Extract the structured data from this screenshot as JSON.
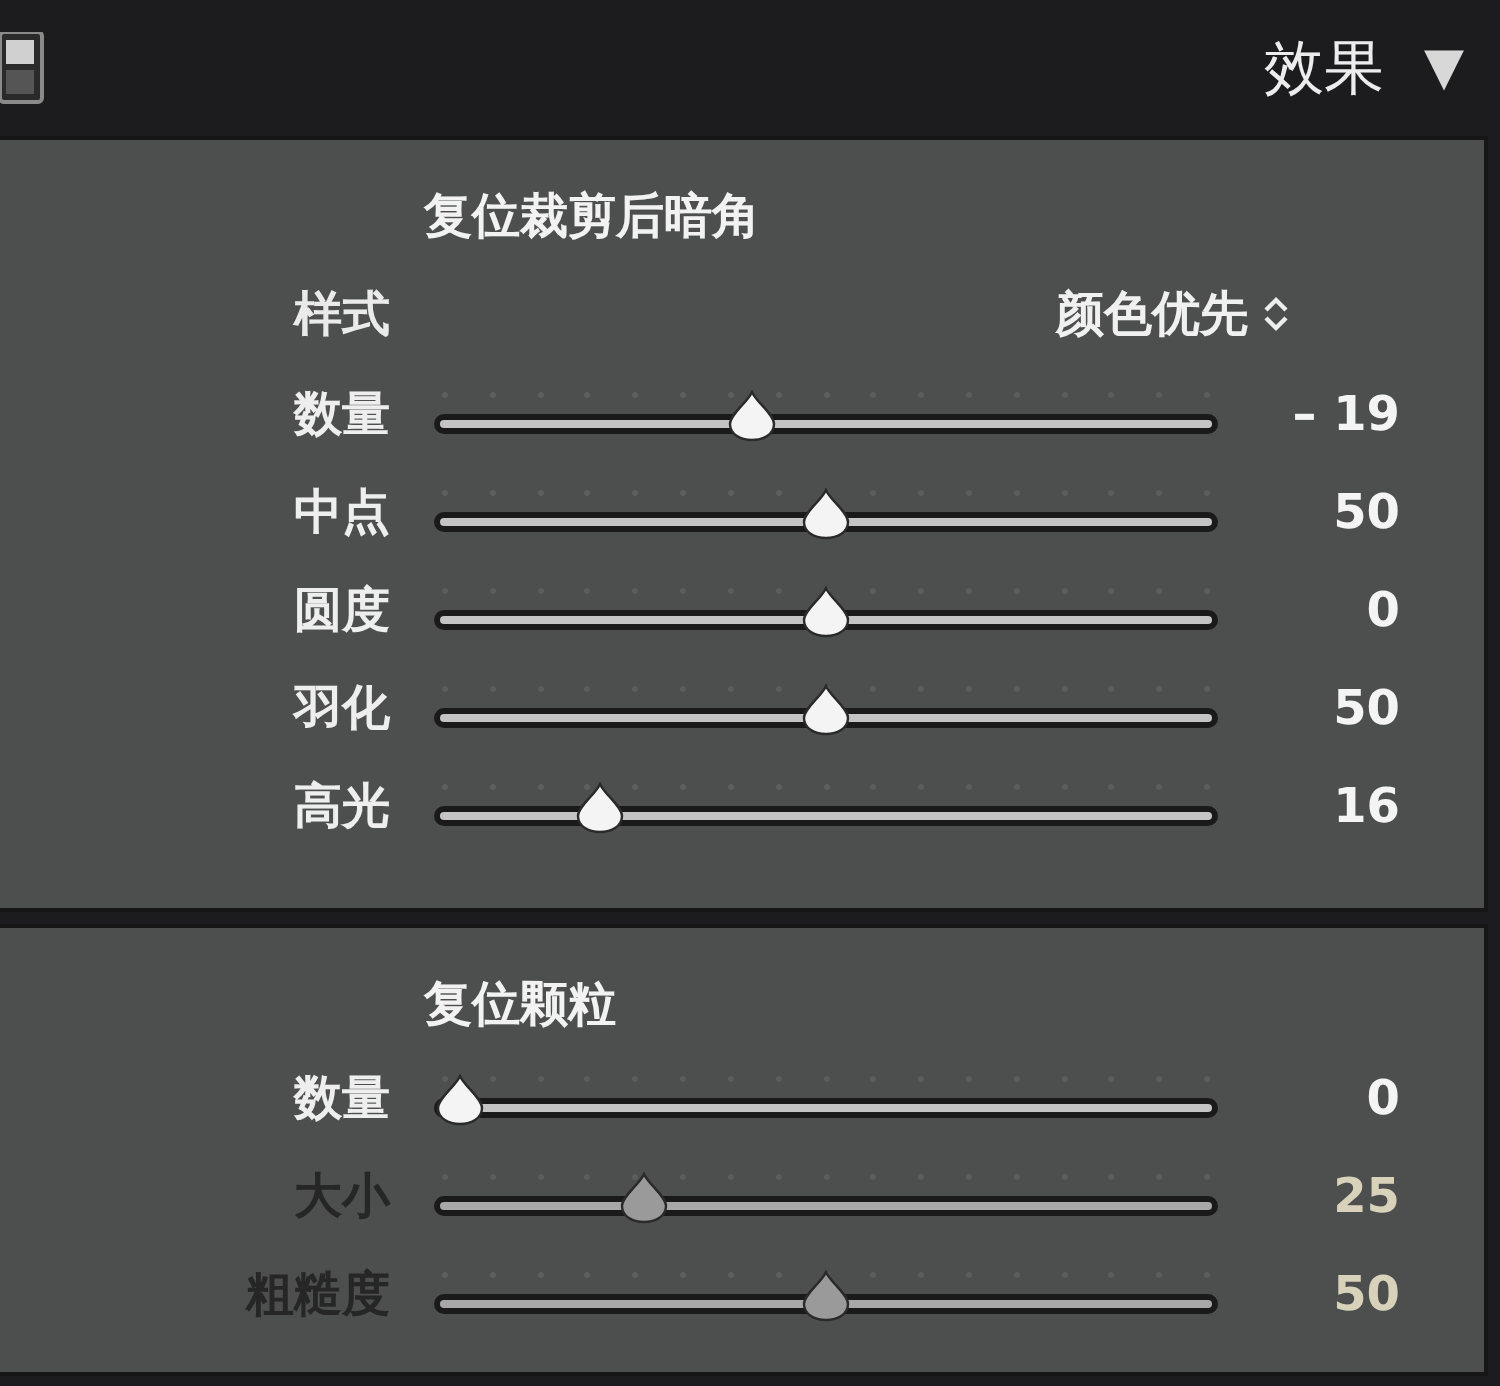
{
  "header": {
    "title": "效果",
    "collapse_glyph": "▼"
  },
  "sections": [
    {
      "title": "复位裁剪后暗角",
      "style": {
        "label": "样式",
        "value": "颜色优先"
      },
      "sliders": [
        {
          "label": "数量",
          "value": "– 19",
          "level": 0.4,
          "disabled": false
        },
        {
          "label": "中点",
          "value": "50",
          "level": 0.5,
          "disabled": false
        },
        {
          "label": "圆度",
          "value": "0",
          "level": 0.5,
          "disabled": false
        },
        {
          "label": "羽化",
          "value": "50",
          "level": 0.5,
          "disabled": false
        },
        {
          "label": "高光",
          "value": "16",
          "level": 0.19,
          "disabled": false
        }
      ]
    },
    {
      "title": "复位颗粒",
      "sliders": [
        {
          "label": "数量",
          "value": "0",
          "level": 0,
          "disabled": false
        },
        {
          "label": "大小",
          "value": "25",
          "level": 0.25,
          "disabled": true
        },
        {
          "label": "粗糙度",
          "value": "50",
          "level": 0.5,
          "disabled": true
        }
      ]
    }
  ]
}
